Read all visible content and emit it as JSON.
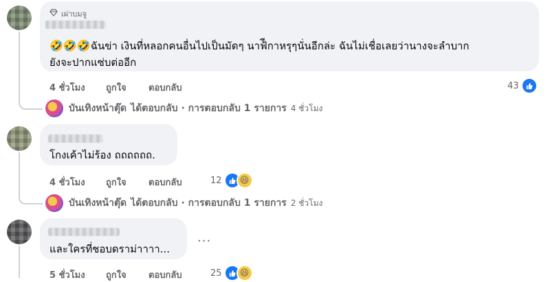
{
  "comments": [
    {
      "badge": "เผ่าบมจู",
      "emoji_prefix": "🤣🤣🤣",
      "text_line1": "ฉันข่า เงินที่หลอกคนอื่นไปเป็นมัดๆ นาฟ้ีกาหรุๆนั่นอีกล่ะ ฉันไม่เชื่อเลยว่านางจะลำบาก",
      "text_line2": "ยังจะปากแซ่บต่ออีก",
      "time": "4 ชั่วโมง",
      "like": "ถูกใจ",
      "reply": "ตอบกลับ",
      "reactions": "43",
      "reply_summary": {
        "name": "บันเทิงหน้าตุ๊ด",
        "action": "ได้ตอบกลับ · การตอบกลับ 1 รายการ",
        "time": "4 ชั่วโมง"
      }
    },
    {
      "text_line1": "โกงเค้าไม่ร้อง ถถถถถถ.",
      "time": "4 ชั่วโมง",
      "like": "ถูกใจ",
      "reply": "ตอบกลับ",
      "reactions": "12",
      "reply_summary": {
        "name": "บันเทิงหน้าตุ๊ด",
        "action": "ได้ตอบกลับ · การตอบกลับ 1 รายการ",
        "time": "2 ชั่วโมง"
      }
    },
    {
      "text_line1": "และใครที่ชอบดราม่าาาา...",
      "more": "...",
      "time": "5 ชั่วโมง",
      "like": "ถูกใจ",
      "reply": "ตอบกลับ",
      "reactions": "25"
    }
  ],
  "icons": {
    "badge": "diamond-icon",
    "like": "thumbs-up-icon",
    "haha": "laughing-face-icon",
    "more": "more-dots-icon"
  },
  "colors": {
    "bubble": "#f0f2f5",
    "meta": "#65676b",
    "like_blue": "#1877f2",
    "thread_line": "#ced0d4"
  }
}
